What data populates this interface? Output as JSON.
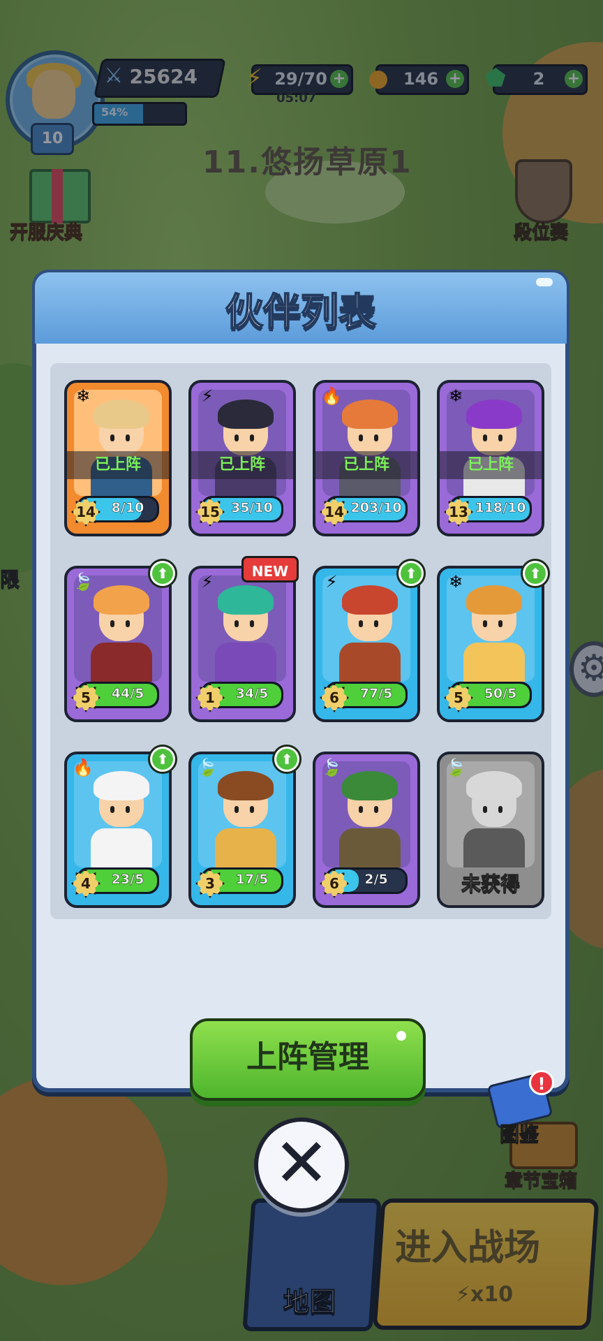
{
  "hud": {
    "avatar_level": "10",
    "power": "25624",
    "exp_percent_label": "54%",
    "exp_fraction": 0.54,
    "energy": "29/70",
    "energy_timer": "05:07",
    "coins": "146",
    "gems": "2",
    "plus": "+"
  },
  "stage": {
    "title": "11.悠扬草原1"
  },
  "side": {
    "event_label": "开服庆典",
    "rank_label": "段位赛",
    "limited_label": "限",
    "chest_label": "章节宝箱"
  },
  "modal": {
    "title": "伙伴列表",
    "deploy_button": "上阵管理",
    "codex_label": "图鉴",
    "codex_alert": "!"
  },
  "labels": {
    "deployed": "已上阵",
    "new_tag": "NEW",
    "not_obtained": "未获得",
    "upgrade": "⬆"
  },
  "partners": [
    {
      "card": "orange",
      "element": "❄",
      "star": "14",
      "count": "8/10",
      "progress": 0.8,
      "deployed": true
    },
    {
      "card": "purple",
      "element": "⚡",
      "star": "15",
      "count": "35/10",
      "progress": 1.0,
      "deployed": true
    },
    {
      "card": "purple",
      "element": "🔥",
      "star": "14",
      "count": "203/10",
      "progress": 1.0,
      "deployed": true
    },
    {
      "card": "purple",
      "element": "❄",
      "star": "13",
      "count": "118/10",
      "progress": 1.0,
      "deployed": true
    },
    {
      "card": "purple",
      "element": "🍃",
      "star": "5",
      "count": "44/5",
      "progress": 1.0,
      "upgrade": true
    },
    {
      "card": "purple",
      "element": "⚡",
      "star": "1",
      "count": "34/5",
      "progress": 1.0,
      "new": true
    },
    {
      "card": "blue",
      "element": "⚡",
      "star": "6",
      "count": "77/5",
      "progress": 1.0,
      "upgrade": true
    },
    {
      "card": "blue",
      "element": "❄",
      "star": "5",
      "count": "50/5",
      "progress": 1.0,
      "upgrade": true
    },
    {
      "card": "blue",
      "element": "🔥",
      "star": "4",
      "count": "23/5",
      "progress": 1.0,
      "upgrade": true
    },
    {
      "card": "blue",
      "element": "🍃",
      "star": "3",
      "count": "17/5",
      "progress": 1.0,
      "upgrade": true
    },
    {
      "card": "purple",
      "element": "🍃",
      "star": "6",
      "count": "2/5",
      "progress": 0.4
    },
    {
      "card": "gray",
      "element": "🍃",
      "locked": true
    }
  ],
  "bottom": {
    "close_icon": "✕",
    "map_label": "地图",
    "battle_label": "进入战场",
    "battle_cost": "x10"
  }
}
